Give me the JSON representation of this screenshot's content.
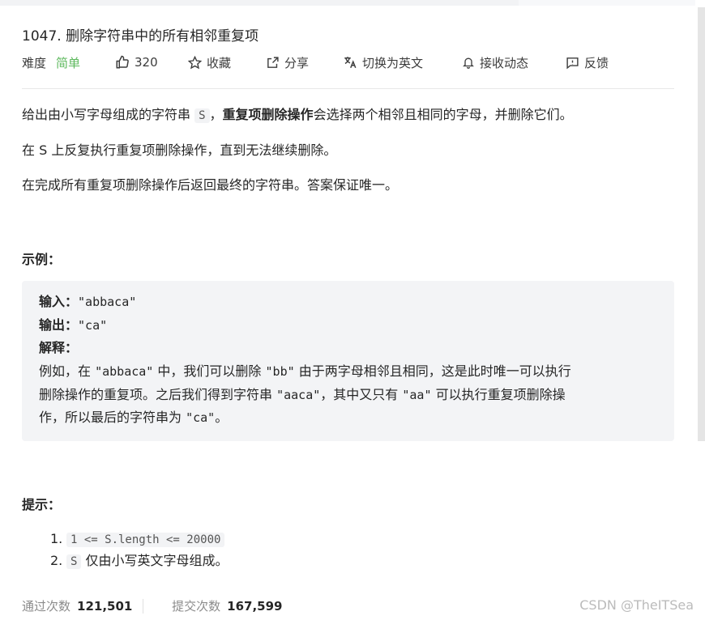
{
  "problem": {
    "title": "1047. 删除字符串中的所有相邻重复项",
    "difficulty_label": "难度",
    "difficulty_value": "简单",
    "likes": "320",
    "favorite_label": "收藏",
    "share_label": "分享",
    "translate_label": "切换为英文",
    "notify_label": "接收动态",
    "feedback_label": "反馈"
  },
  "description": {
    "p1_a": "给出由小写字母组成的字符串 ",
    "p1_code": "S",
    "p1_b": "，",
    "p1_bold": "重复项删除操作",
    "p1_c": "会选择两个相邻且相同的字母，并删除它们。",
    "p2": "在 S 上反复执行重复项删除操作，直到无法继续删除。",
    "p3": "在完成所有重复项删除操作后返回最终的字符串。答案保证唯一。"
  },
  "example": {
    "heading": "示例：",
    "input_label": "输入：",
    "input_value": "\"abbaca\"",
    "output_label": "输出：",
    "output_value": "\"ca\"",
    "explain_label": "解释：",
    "explain_line1_a": "例如，在 ",
    "explain_line1_b": "\"abbaca\"",
    "explain_line1_c": " 中，我们可以删除 ",
    "explain_line1_d": "\"bb\"",
    "explain_line1_e": " 由于两字母相邻且相同，这是此时唯一可以执行",
    "explain_line2_a": "删除操作的重复项。之后我们得到字符串 ",
    "explain_line2_b": "\"aaca\"",
    "explain_line2_c": "，其中又只有 ",
    "explain_line2_d": "\"aa\"",
    "explain_line2_e": " 可以执行重复项删除操",
    "explain_line3_a": "作，所以最后的字符串为 ",
    "explain_line3_b": "\"ca\"",
    "explain_line3_c": "。"
  },
  "hints": {
    "heading": "提示：",
    "items": [
      {
        "num": "1.",
        "code": "1 <= S.length <= 20000",
        "text": ""
      },
      {
        "num": "2.",
        "code": "S",
        "text": " 仅由小写英文字母组成。"
      }
    ]
  },
  "stats": {
    "accepted_label": "通过次数",
    "accepted_value": "121,501",
    "submitted_label": "提交次数",
    "submitted_value": "167,599"
  },
  "watermark": "CSDN @TheITSea",
  "colors": {
    "easy": "#5cb85c",
    "text": "#262626",
    "muted": "#8c8c8c",
    "example_bg": "#f3f4f6"
  }
}
